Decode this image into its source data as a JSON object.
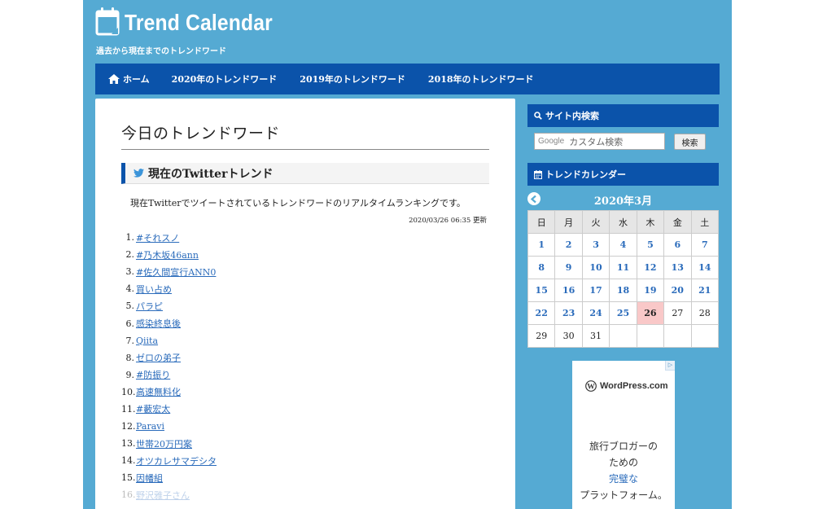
{
  "header": {
    "site_title": "Trend Calendar",
    "tagline": "過去から現在までのトレンドワード"
  },
  "nav": {
    "items": [
      {
        "label": "ホーム",
        "icon": "home-icon"
      },
      {
        "label": "2020年のトレンドワード"
      },
      {
        "label": "2019年のトレンドワード"
      },
      {
        "label": "2018年のトレンドワード"
      }
    ]
  },
  "main": {
    "page_title": "今日のトレンドワード",
    "section_title": "現在のTwitterトレンド",
    "description": "現在Twitterでツイートされているトレンドワードのリアルタイムランキングです。",
    "updated": "2020/03/26 06:35 更新",
    "trends": [
      {
        "rank": "1.",
        "word": "#それスノ"
      },
      {
        "rank": "2.",
        "word": "#乃木坂46ann"
      },
      {
        "rank": "3.",
        "word": "#佐久間宣行ANN0"
      },
      {
        "rank": "4.",
        "word": "買い占め"
      },
      {
        "rank": "5.",
        "word": "パラピ"
      },
      {
        "rank": "6.",
        "word": "感染終息後"
      },
      {
        "rank": "7.",
        "word": "Qiita"
      },
      {
        "rank": "8.",
        "word": "ゼロの弟子"
      },
      {
        "rank": "9.",
        "word": "#防振り"
      },
      {
        "rank": "10.",
        "word": "高速無料化"
      },
      {
        "rank": "11.",
        "word": "#藪宏太"
      },
      {
        "rank": "12.",
        "word": "Paravi"
      },
      {
        "rank": "13.",
        "word": "世帯20万円案"
      },
      {
        "rank": "14.",
        "word": "オツカレサマデシタ"
      },
      {
        "rank": "15.",
        "word": "因幡組"
      },
      {
        "rank": "16.",
        "word": "野沢雅子さん"
      }
    ]
  },
  "sidebar": {
    "search_heading": "サイト内検索",
    "search_placeholder": "カスタム検索",
    "search_brand": "Google",
    "search_button": "検索",
    "calendar_heading": "トレンドカレンダー",
    "calendar": {
      "month": "2020年3月",
      "weekdays": [
        "日",
        "月",
        "火",
        "水",
        "木",
        "金",
        "土"
      ],
      "weeks": [
        [
          "1",
          "2",
          "3",
          "4",
          "5",
          "6",
          "7"
        ],
        [
          "8",
          "9",
          "10",
          "11",
          "12",
          "13",
          "14"
        ],
        [
          "15",
          "16",
          "17",
          "18",
          "19",
          "20",
          "21"
        ],
        [
          "22",
          "23",
          "24",
          "25",
          "26",
          "27",
          "28"
        ],
        [
          "29",
          "30",
          "31",
          "",
          "",
          "",
          ""
        ]
      ],
      "linked_through": 25,
      "today": "26"
    },
    "ad": {
      "brand": "WordPress.com",
      "line1": "旅行ブロガーの",
      "line2": "ための",
      "line3": "完璧な",
      "line4": "プラットフォーム。"
    }
  },
  "colors": {
    "background": "#55aad3",
    "nav": "#0b53aa",
    "link": "#2a6bbb",
    "today": "#f9c8c8"
  }
}
